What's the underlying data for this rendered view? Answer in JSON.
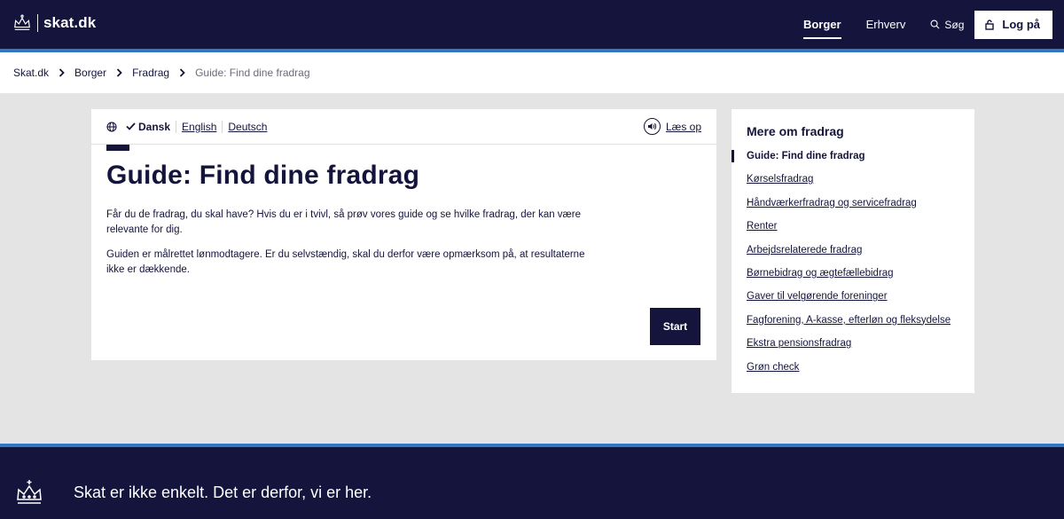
{
  "header": {
    "brand": "skat.dk",
    "nav": [
      {
        "label": "Borger",
        "active": true
      },
      {
        "label": "Erhverv",
        "active": false
      }
    ],
    "search_label": "Søg",
    "login_label": "Log på"
  },
  "breadcrumb": {
    "items": [
      "Skat.dk",
      "Borger",
      "Fradrag"
    ],
    "current": "Guide: Find dine fradrag"
  },
  "main": {
    "languages": {
      "current": "Dansk",
      "others": [
        "English",
        "Deutsch"
      ]
    },
    "read_aloud_label": "Læs op",
    "title": "Guide: Find dine fradrag",
    "paragraphs": [
      "Får du de fradrag, du skal have? Hvis du er i tvivl, så prøv vores guide og se hvilke fradrag, der kan være relevante for dig.",
      "Guiden er målrettet lønmodtagere. Er du selvstændig, skal du derfor være opmærksom på, at resulta­terne ikke er dækkende."
    ],
    "start_label": "Start"
  },
  "sidebar": {
    "title": "Mere om fradrag",
    "items": [
      {
        "label": "Guide: Find dine fradrag",
        "current": true
      },
      {
        "label": "Kørselsfradrag",
        "current": false
      },
      {
        "label": "Håndværkerfradrag og servicefradrag",
        "current": false
      },
      {
        "label": "Renter",
        "current": false
      },
      {
        "label": "Arbejdsrelaterede fradrag",
        "current": false
      },
      {
        "label": "Børnebidrag og ægtefællebidrag",
        "current": false
      },
      {
        "label": "Gaver til velgørende foreninger",
        "current": false
      },
      {
        "label": "Fagforening, A-kasse, efterløn og fleksydelse",
        "current": false
      },
      {
        "label": "Ekstra pensionsfradrag",
        "current": false
      },
      {
        "label": "Grøn check",
        "current": false
      }
    ]
  },
  "footer": {
    "tagline": "Skat er ikke enkelt. Det er derfor, vi er her."
  },
  "colors": {
    "navy": "#14143c",
    "accent_blue": "#2e78c6",
    "background": "#e4e4e4"
  },
  "icons": [
    "crown-icon",
    "search-icon",
    "lock-icon",
    "chevron-right-icon",
    "globe-icon",
    "checkmark-icon",
    "speaker-icon"
  ]
}
